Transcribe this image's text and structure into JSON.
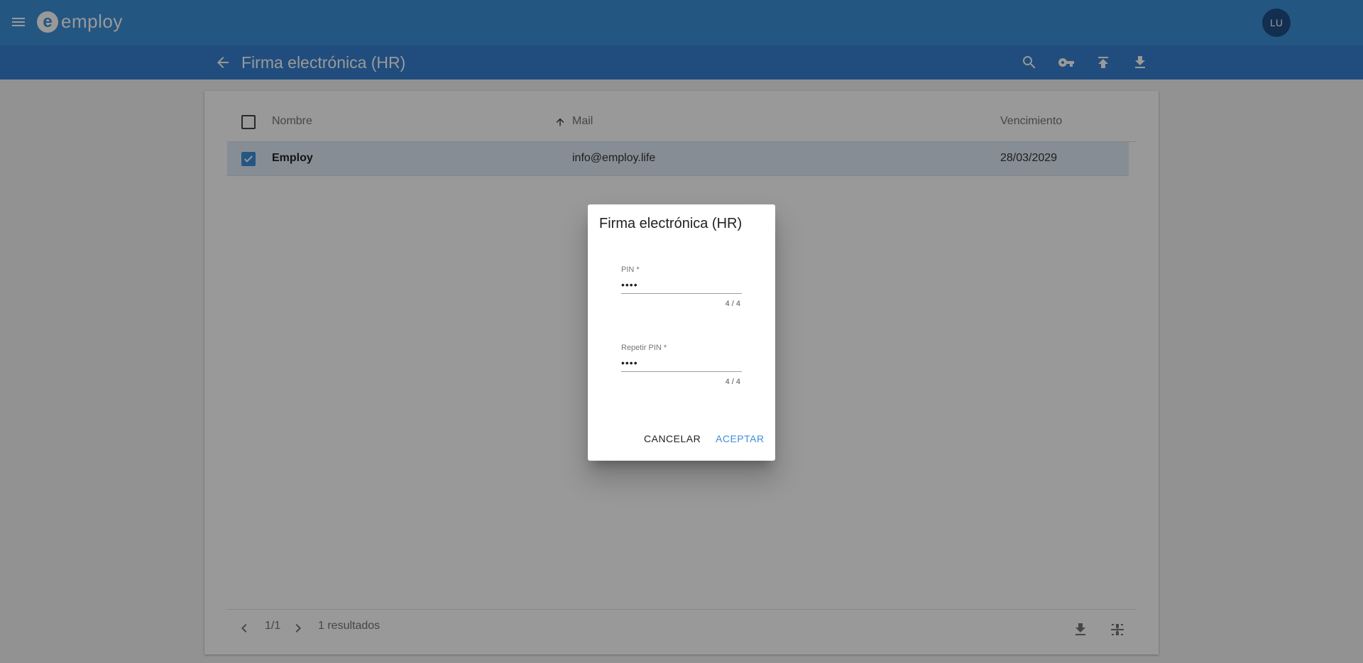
{
  "app": {
    "logo_letter": "e",
    "logo_text": "employ",
    "avatar_initials": "LU"
  },
  "header": {
    "title": "Firma electrónica (HR)"
  },
  "table": {
    "columns": {
      "nombre": "Nombre",
      "mail": "Mail",
      "vencimiento": "Vencimiento"
    },
    "sort_column": "Mail",
    "rows": [
      {
        "nombre": "Employ",
        "mail": "info@employ.life",
        "vencimiento": "28/03/2029",
        "selected": true
      }
    ]
  },
  "footer": {
    "page": "1/1",
    "results": "1 resultados"
  },
  "dialog": {
    "title": "Firma electrónica (HR)",
    "pin": {
      "label": "PIN *",
      "value": "••••",
      "counter": "4 / 4"
    },
    "repeat_pin": {
      "label": "Repetir PIN *",
      "value": "••••",
      "counter": "4 / 4"
    },
    "cancel_label": "CANCELAR",
    "accept_label": "ACEPTAR"
  },
  "colors": {
    "primary": "#3d8fd9",
    "subbar": "#3680d0",
    "avatar": "#1f4f86",
    "row_selected": "#e0ecf8"
  },
  "icons": [
    "menu-icon",
    "back-icon",
    "search-icon",
    "key-icon",
    "upload-icon",
    "download-icon",
    "sort-arrow-up-icon",
    "check-icon",
    "chevron-left-icon",
    "chevron-right-icon",
    "fit-icon"
  ]
}
